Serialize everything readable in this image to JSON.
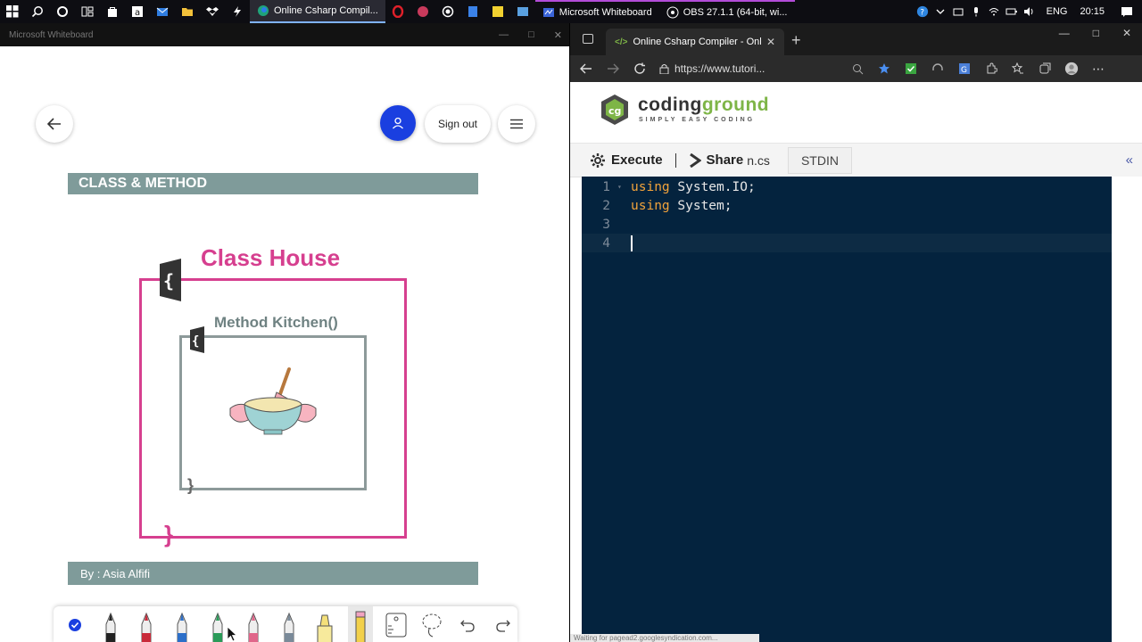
{
  "taskbar": {
    "apps": [
      {
        "label": "Online Csharp Compil..."
      },
      {
        "label": "Microsoft Whiteboard"
      },
      {
        "label": "OBS 27.1.1 (64-bit, wi..."
      }
    ],
    "tray": {
      "language": "ENG",
      "time": "20:15"
    }
  },
  "whiteboard": {
    "window_title": "Microsoft Whiteboard",
    "sign_out_label": "Sign out",
    "banner_top": "CLASS & METHOD",
    "class_title": "Class House",
    "method_title": "Method Kitchen()",
    "banner_bottom": "By : Asia Alfifi"
  },
  "browser": {
    "tab_title": "Online Csharp Compiler - Online",
    "url": "https://www.tutori...",
    "site": {
      "name_part1": "coding",
      "name_part2": "ground",
      "tagline": "SIMPLY EASY CODING"
    },
    "toolbar": {
      "execute_label": "Execute",
      "share_label": "Share",
      "file_tab_label": "n.cs",
      "stdin_tab_label": "STDIN"
    },
    "editor": {
      "lines": [
        {
          "num": "1",
          "kw": "using",
          "rest": " System.IO;"
        },
        {
          "num": "2",
          "kw": "using",
          "rest": " System;"
        },
        {
          "num": "3",
          "kw": "",
          "rest": ""
        },
        {
          "num": "4",
          "kw": "",
          "rest": ""
        }
      ]
    },
    "status_text": "Waiting for pagead2.googlesyndication.com..."
  }
}
